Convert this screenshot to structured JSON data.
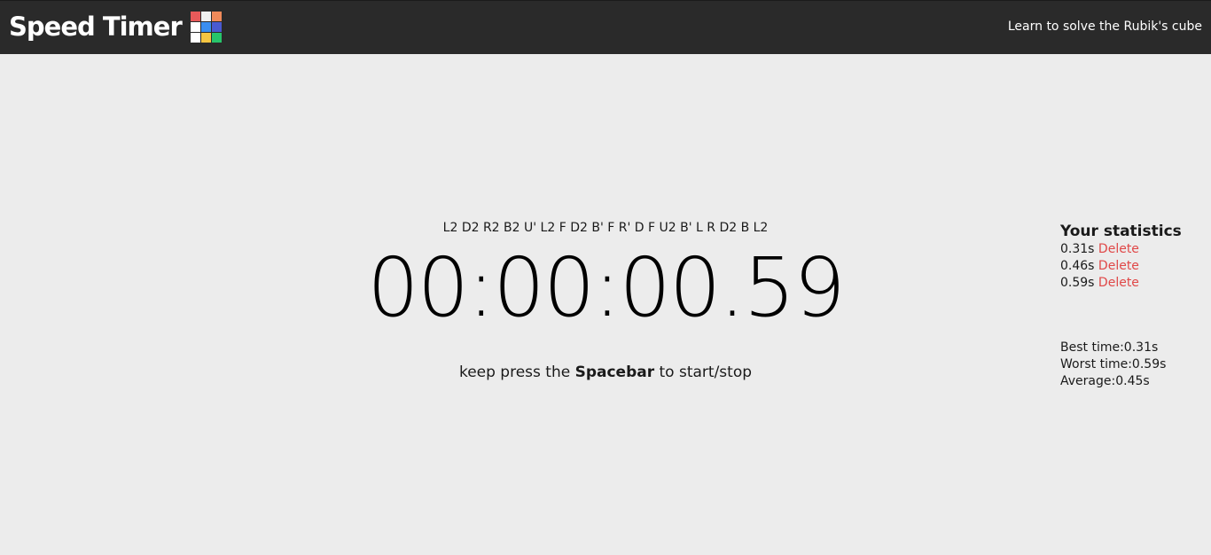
{
  "header": {
    "title": "Speed Timer",
    "learn_link": "Learn to solve the Rubik's cube",
    "logo_colors": [
      "#e85a5a",
      "#f0f0f0",
      "#f08a5a",
      "#ffffff",
      "#3a8ef0",
      "#4a5ad0",
      "#ffffff",
      "#f5c542",
      "#27c46a"
    ]
  },
  "main": {
    "scramble": "L2 D2 R2 B2 U' L2 F D2 B' F R' D F U2 B' L R D2 B L2",
    "timer": "00:00:00.59",
    "hint": {
      "before": "keep press the ",
      "key": "Spacebar",
      "after": " to start/stop"
    }
  },
  "stats": {
    "title": "Your statistics",
    "times": [
      {
        "time": "0.31s",
        "delete_label": "Delete"
      },
      {
        "time": "0.46s",
        "delete_label": "Delete"
      },
      {
        "time": "0.59s",
        "delete_label": "Delete"
      }
    ],
    "best": "Best time:0.31s",
    "worst": "Worst time:0.59s",
    "average": "Average:0.45s"
  },
  "colors": {
    "header_bg": "#2a2a2a",
    "page_bg": "#ececec",
    "delete": "#e04848"
  }
}
